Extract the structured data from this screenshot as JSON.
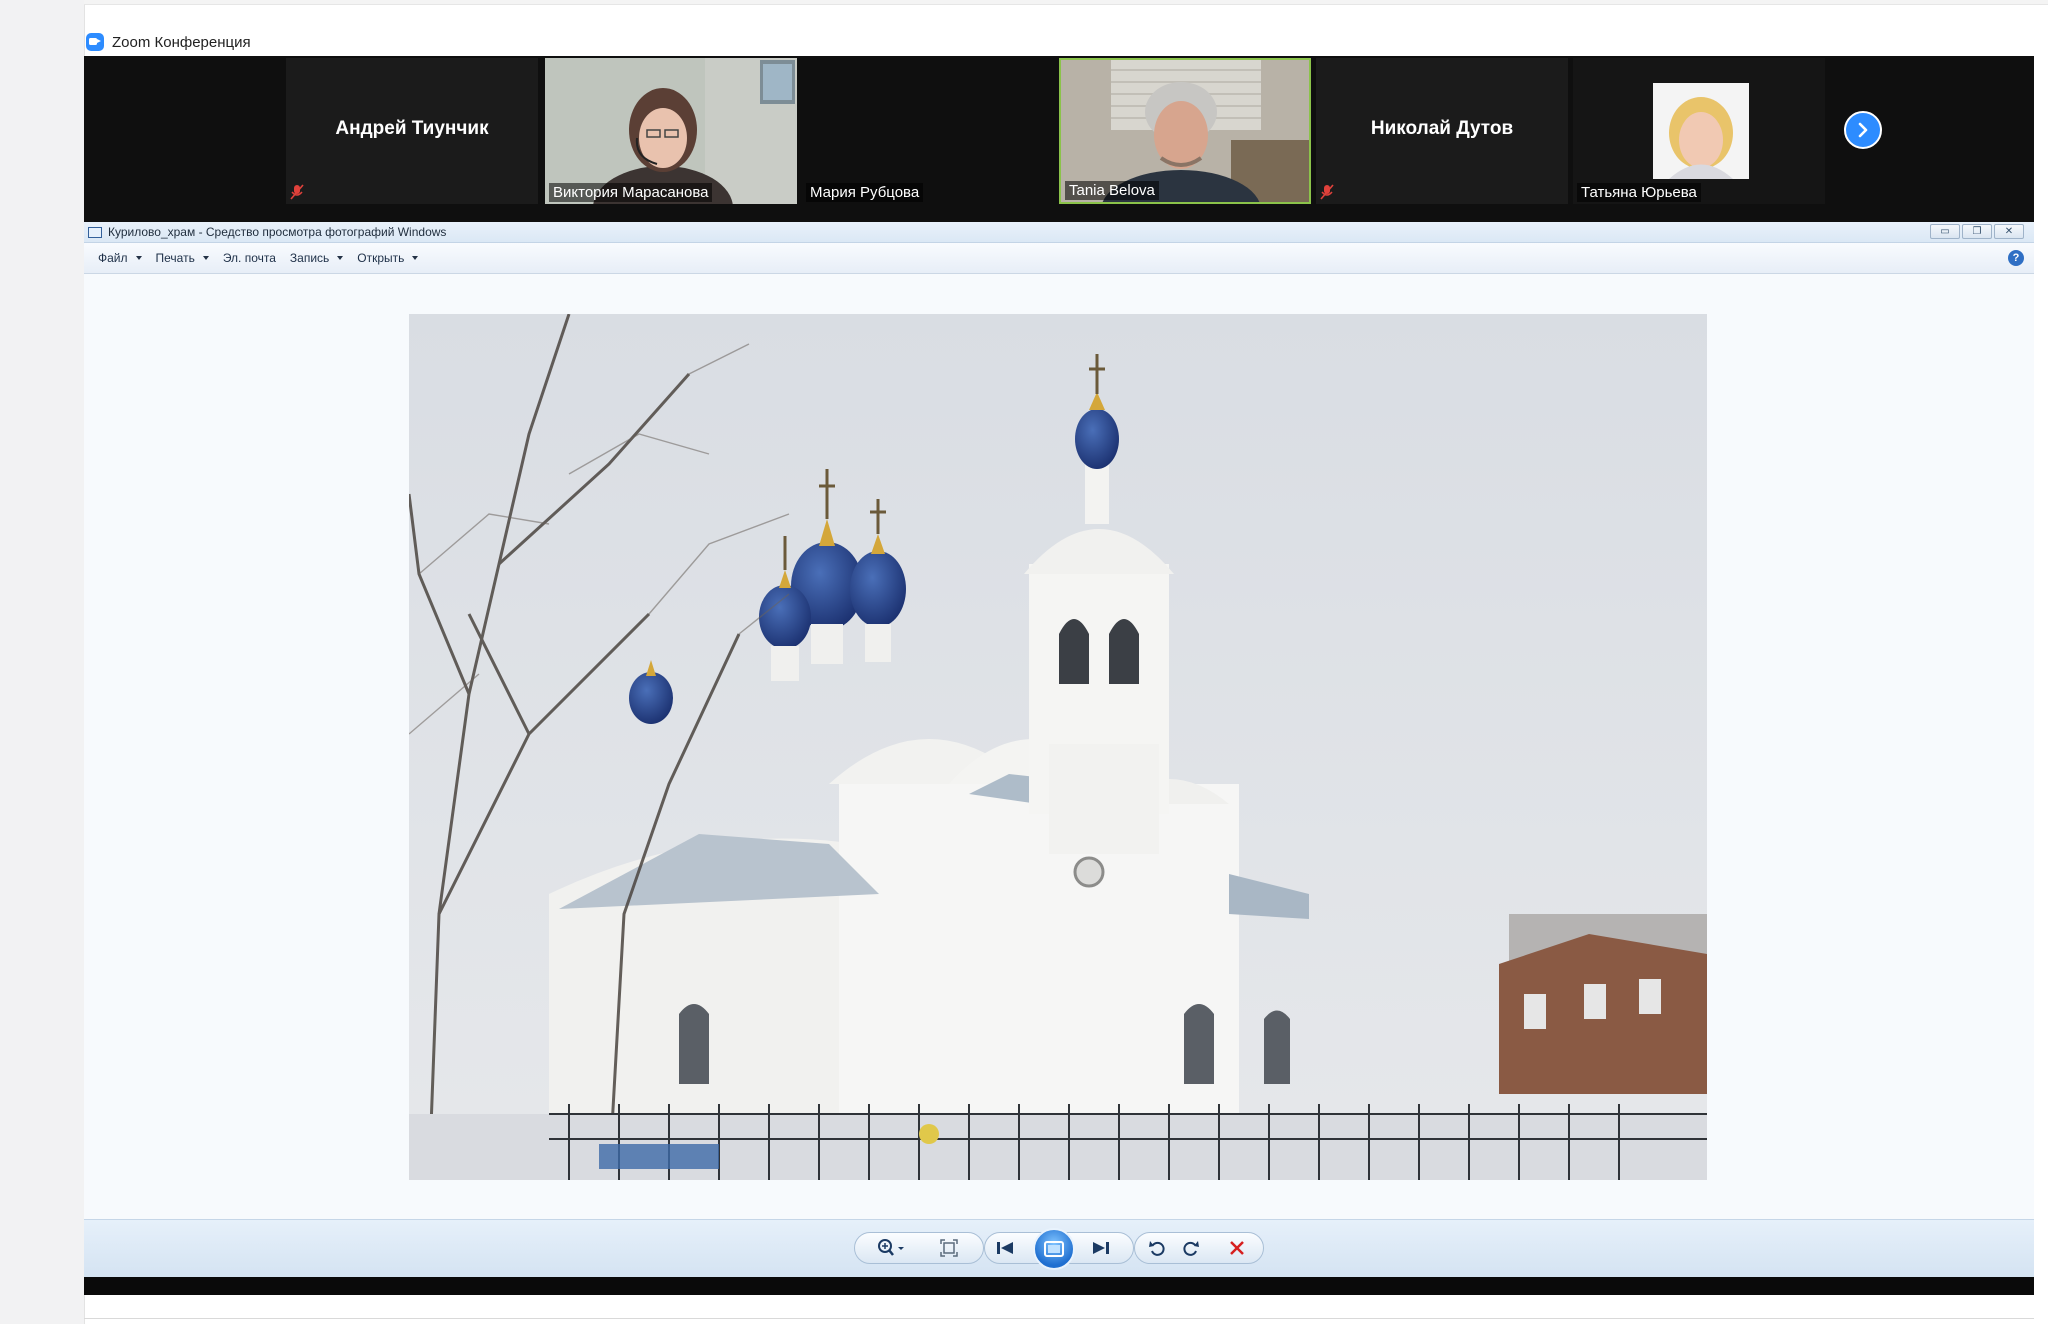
{
  "zoom": {
    "title": "Zoom Конференция",
    "participants": [
      {
        "name": "Андрей Тиунчик",
        "display": "name-only",
        "muted": true
      },
      {
        "name": "Виктория Марасанова",
        "display": "video",
        "muted": false
      },
      {
        "name": "Мария Рубцова",
        "display": "label-only",
        "muted": false
      },
      {
        "name": "Tania Belova",
        "display": "video",
        "muted": false,
        "active_speaker": true
      },
      {
        "name": "Николай Дутов",
        "display": "name-only",
        "muted": true
      },
      {
        "name": "Татьяна Юрьева",
        "display": "photo",
        "muted": false
      }
    ],
    "next_icon": "chevron-right-icon",
    "accent": "#2d8cff",
    "active_border": "#8bc34a"
  },
  "viewer": {
    "window_title": "Курилово_храм - Средство просмотра фотографий Windows",
    "window_buttons": [
      "minimize",
      "restore",
      "close"
    ],
    "menu": [
      {
        "label": "Файл",
        "dropdown": true
      },
      {
        "label": "Печать",
        "dropdown": true
      },
      {
        "label": "Эл. почта",
        "dropdown": false
      },
      {
        "label": "Запись",
        "dropdown": true
      },
      {
        "label": "Открыть",
        "dropdown": true
      }
    ],
    "help_label": "?",
    "photo_subject": "white church with blue onion domes in winter",
    "controls": [
      "zoom",
      "actual-size",
      "previous",
      "slideshow",
      "next",
      "rotate-counterclockwise",
      "rotate-clockwise",
      "delete"
    ],
    "delete_color": "#d61f1f"
  }
}
